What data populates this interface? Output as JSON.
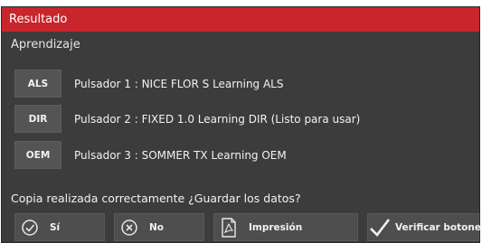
{
  "dialog": {
    "title": "Resultado",
    "section_label": "Aprendizaje",
    "remotes": [
      {
        "tag": "ALS",
        "text": "Pulsador 1 : NICE FLOR S Learning ALS"
      },
      {
        "tag": "DIR",
        "text": "Pulsador 2 : FIXED 1.0 Learning DIR (Listo para usar)"
      },
      {
        "tag": "OEM",
        "text": "Pulsador 3 : SOMMER TX Learning OEM"
      }
    ],
    "question": "Copia realizada correctamente ¿Guardar los datos?",
    "buttons": {
      "yes": {
        "label": "Sí",
        "icon": "check-circle-icon"
      },
      "no": {
        "label": "No",
        "icon": "x-circle-icon"
      },
      "print": {
        "label": "Impresión",
        "icon": "pdf-document-icon"
      },
      "verify": {
        "label": "Verificar botones",
        "icon": "checkmark-icon"
      }
    }
  },
  "colors": {
    "titlebar": "#c8252c",
    "background": "#3c3c3c",
    "button": "#4e4e4e"
  }
}
